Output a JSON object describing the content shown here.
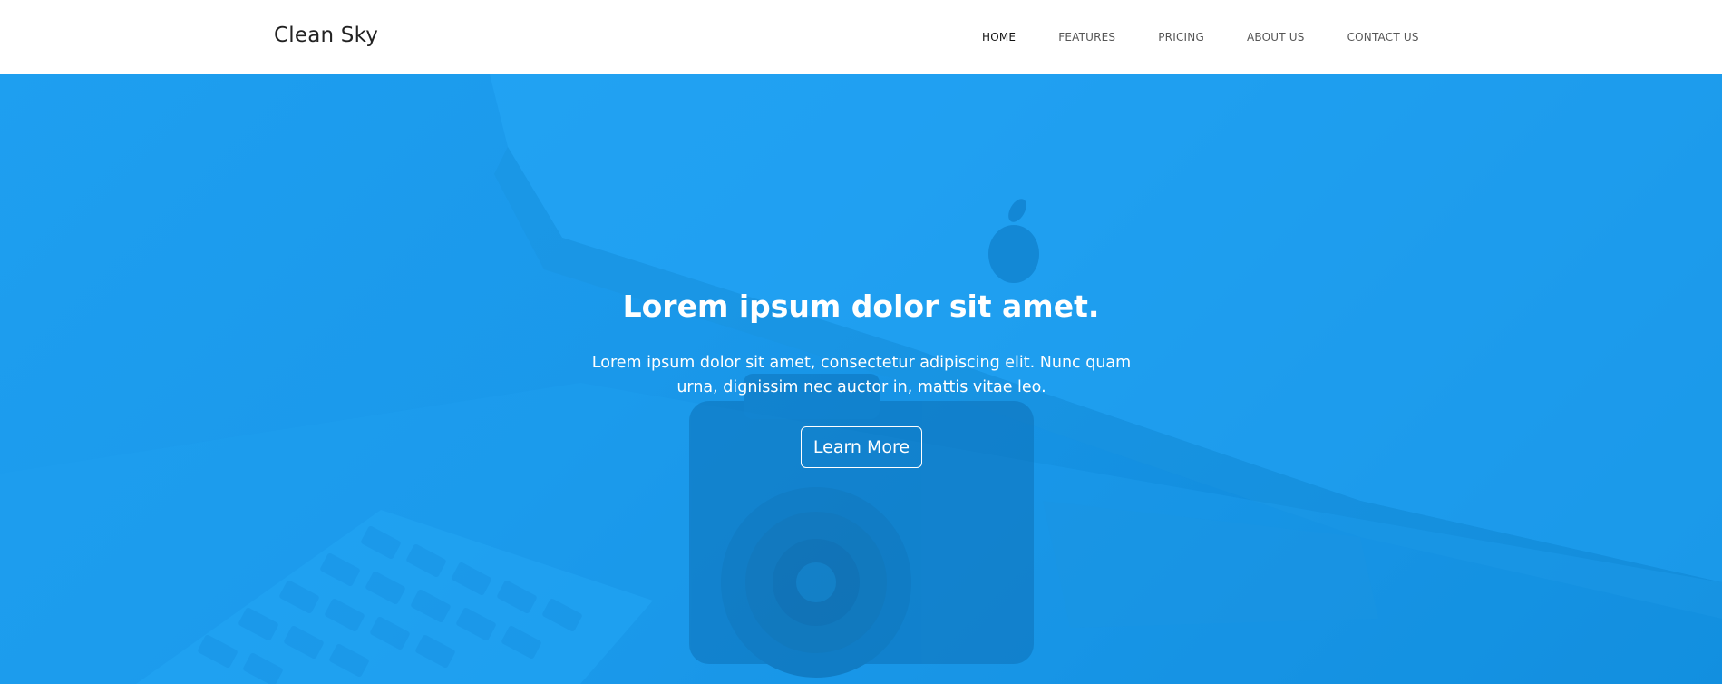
{
  "brand": {
    "name": "Clean Sky"
  },
  "nav": {
    "items": [
      {
        "label": "HOME",
        "active": true
      },
      {
        "label": "FEATURES",
        "active": false
      },
      {
        "label": "PRICING",
        "active": false
      },
      {
        "label": "ABOUT US",
        "active": false
      },
      {
        "label": "CONTACT US",
        "active": false
      }
    ]
  },
  "hero": {
    "title": "Lorem ipsum dolor sit amet.",
    "text": "Lorem ipsum dolor sit amet, consectetur adipiscing elit. Nunc quam urna, dignissim nec auctor in, mattis vitae leo.",
    "button_label": "Learn More",
    "overlay_color": "#1e9ff0"
  },
  "colors": {
    "navbar_bg": "#ffffff",
    "brand_text": "#222222",
    "nav_text": "#555555",
    "nav_active": "#111111",
    "hero_blue": "#1e9ff0",
    "hero_blue_dark": "#0c86d6",
    "hero_text": "#ffffff"
  }
}
